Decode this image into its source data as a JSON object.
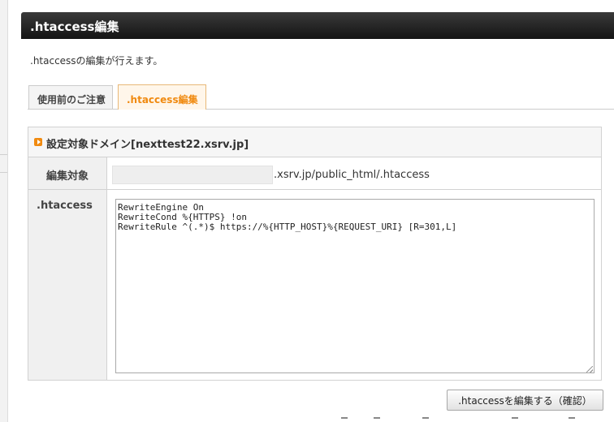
{
  "header": {
    "title": ".htaccess編集"
  },
  "description": ".htaccessの編集が行えます。",
  "tabs": [
    {
      "label": "使用前のご注意",
      "active": false
    },
    {
      "label": ".htaccess編集",
      "active": true
    }
  ],
  "panel": {
    "title": "設定対象ドメイン[nexttest22.xsrv.jp]",
    "target_label": "編集対象",
    "target_path": ".xsrv.jp/public_html/.htaccess",
    "htaccess_label": ".htaccess",
    "htaccess_content": "RewriteEngine On\nRewriteCond %{HTTPS} !on\nRewriteRule ^(.*)$ https://%{HTTP_HOST}%{REQUEST_URI} [R=301,L]"
  },
  "actions": {
    "confirm_label": ".htaccessを編集する（確認）"
  },
  "colors": {
    "accent": "#f08a10",
    "header_bg": "#1e1e1e"
  }
}
